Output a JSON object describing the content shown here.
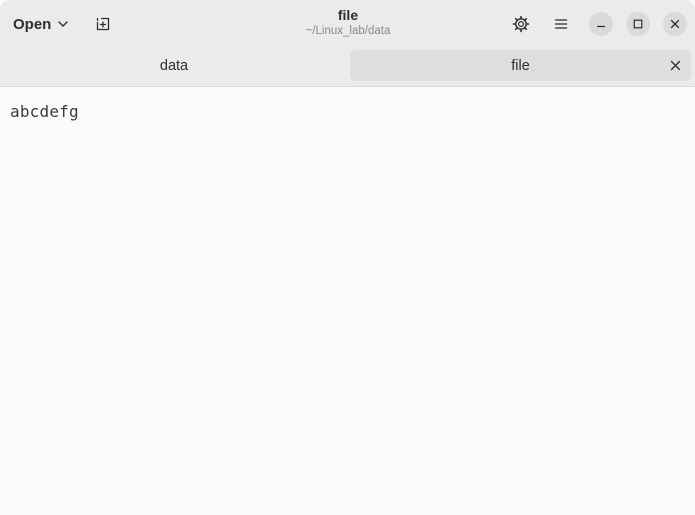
{
  "header": {
    "open_label": "Open",
    "title": "file",
    "subtitle": "~/Linux_lab/data",
    "icons": {
      "open_dropdown": "chevron-down-icon",
      "new_tab": "new-tab-icon",
      "settings": "gear-icon",
      "menu": "hamburger-menu-icon",
      "minimize": "minimize-icon",
      "maximize": "maximize-icon",
      "close": "close-icon"
    }
  },
  "tabs": [
    {
      "label": "data",
      "active": false
    },
    {
      "label": "file",
      "active": true
    }
  ],
  "editor": {
    "lines": [
      "abcdefg"
    ]
  },
  "colors": {
    "headerbar": "#ebebeb",
    "editor_background": "#fafafa",
    "active_tab": "#dedede",
    "window_button": "#dadada"
  }
}
